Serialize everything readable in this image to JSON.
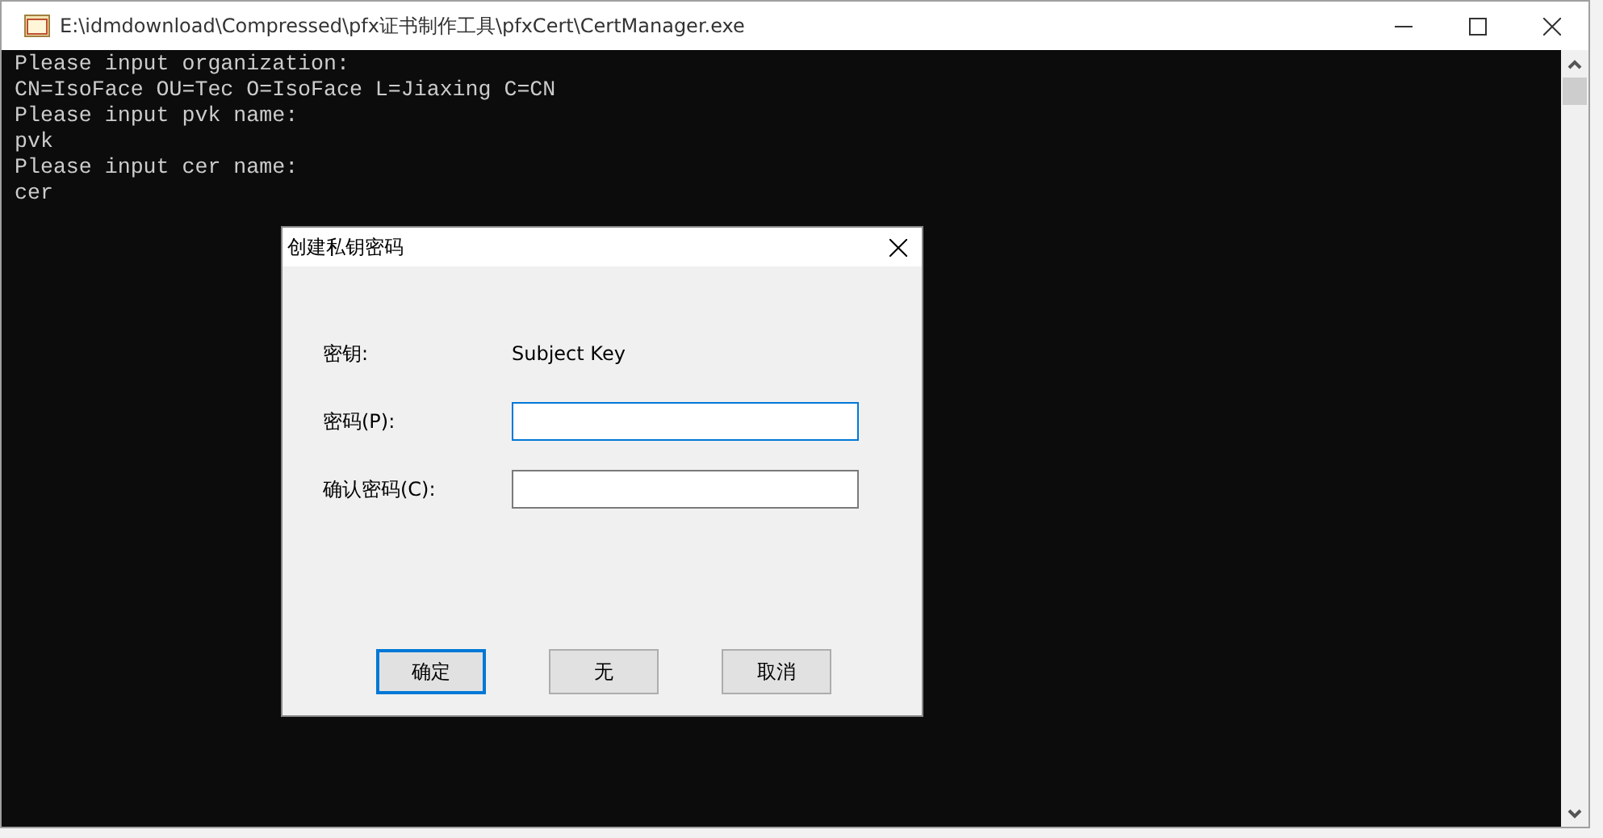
{
  "window": {
    "title": "E:\\idmdownload\\Compressed\\pfx证书制作工具\\pfxCert\\CertManager.exe"
  },
  "console": {
    "lines": [
      "Please input organization:",
      "CN=IsoFace OU=Tec O=IsoFace L=Jiaxing C=CN",
      "Please input pvk name:",
      "pvk",
      "Please input cer name:",
      "cer"
    ]
  },
  "dialog": {
    "title": "创建私钥密码",
    "key_label": "密钥:",
    "key_value": "Subject Key",
    "fields": [
      {
        "label": "密码(P):",
        "focused": true
      },
      {
        "label": "确认密码(C):",
        "focused": false
      }
    ],
    "buttons": [
      {
        "label": "确定",
        "default": true
      },
      {
        "label": "无",
        "default": false
      },
      {
        "label": "取消",
        "default": false
      }
    ]
  }
}
